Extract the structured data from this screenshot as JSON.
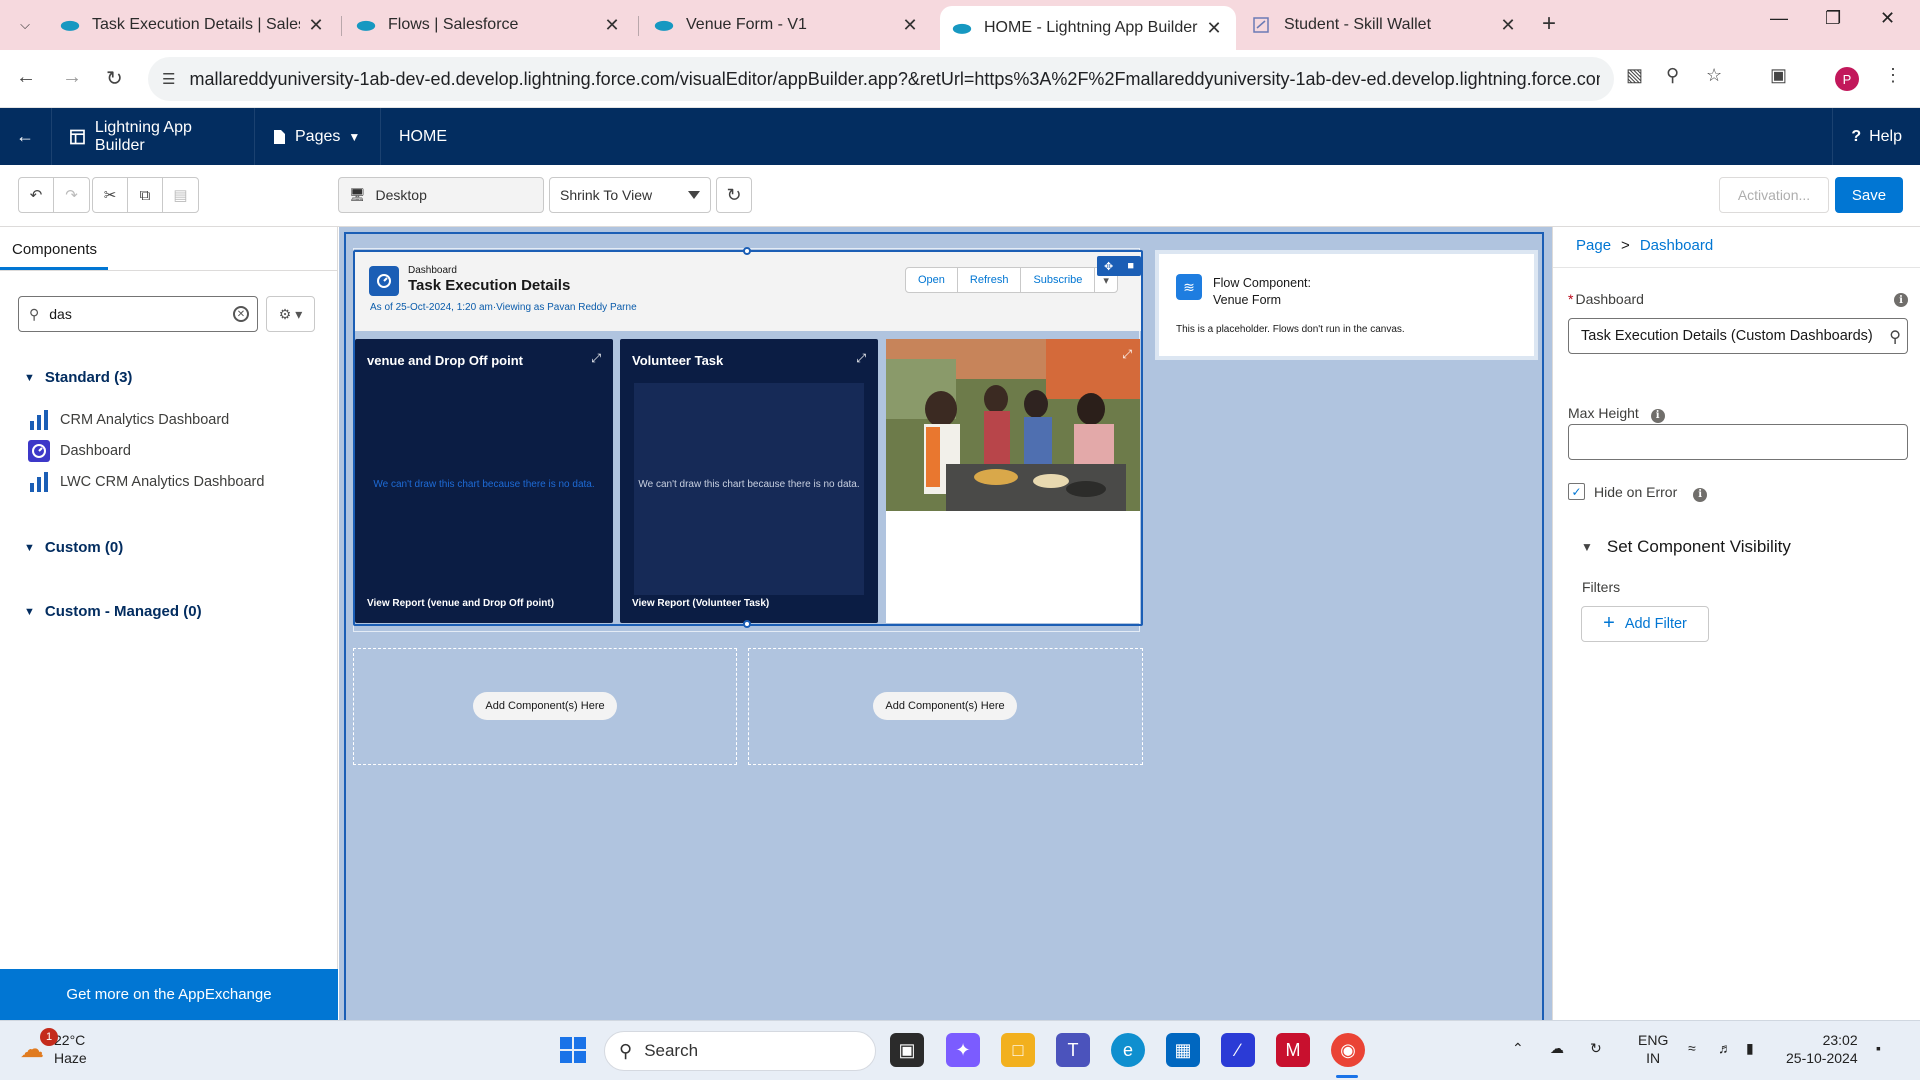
{
  "browser": {
    "tabs": [
      {
        "title": "Task Execution Details | Salesforce",
        "active": false
      },
      {
        "title": "Flows | Salesforce",
        "active": false
      },
      {
        "title": "Venue Form - V1",
        "active": false
      },
      {
        "title": "HOME - Lightning App Builder",
        "active": true
      },
      {
        "title": "Student - Skill Wallet",
        "active": false
      }
    ],
    "url": "mallareddyuniversity-1ab-dev-ed.develop.lightning.force.com/visualEditor/appBuilder.app?&retUrl=https%3A%2F%2Fmallareddyuniversity-1ab-dev-ed.develop.lightning.force.com%...",
    "profile_initial": "P"
  },
  "header": {
    "app_name": "Lightning App Builder",
    "pages_label": "Pages",
    "page_name": "HOME",
    "help_label": "Help"
  },
  "toolbar": {
    "device": "Desktop",
    "zoom": "Shrink To View",
    "activation_label": "Activation...",
    "save_label": "Save"
  },
  "left_panel": {
    "tab_label": "Components",
    "search_value": "das",
    "sections": {
      "standard": "Standard (3)",
      "custom": "Custom (0)",
      "managed": "Custom - Managed (0)"
    },
    "items": [
      "CRM Analytics Dashboard",
      "Dashboard",
      "LWC CRM Analytics Dashboard"
    ],
    "appexchange_label": "Get more on the AppExchange"
  },
  "canvas": {
    "dashboard": {
      "small_label": "Dashboard",
      "title": "Task Execution Details",
      "meta": "As of 25-Oct-2024, 1:20 am·Viewing as Pavan Reddy Parne",
      "buttons": [
        "Open",
        "Refresh",
        "Subscribe"
      ],
      "widgets": [
        {
          "title": "venue and Drop Off point",
          "nodata": "We can't draw this chart because there is no data.",
          "report": "View Report (venue and Drop Off point)"
        },
        {
          "title": "Volunteer Task",
          "nodata": "We can't draw this chart because there is no data.",
          "report": "View Report (Volunteer Task)"
        }
      ]
    },
    "add_component_label": "Add Component(s) Here",
    "flow": {
      "line1": "Flow Component:",
      "line2": "Venue Form",
      "placeholder": "This is a placeholder. Flows don't run in the canvas."
    }
  },
  "right_panel": {
    "breadcrumb_root": "Page",
    "breadcrumb_sep": ">",
    "breadcrumb_current": "Dashboard",
    "dashboard_label": "Dashboard",
    "dashboard_value": "Task Execution Details (Custom Dashboards)",
    "max_height_label": "Max Height",
    "max_height_value": "",
    "hide_on_error_label": "Hide on Error",
    "hide_on_error_checked": true,
    "visibility_label": "Set Component Visibility",
    "filters_label": "Filters",
    "add_filter_label": "Add Filter"
  },
  "taskbar": {
    "temperature": "22°C",
    "condition": "Haze",
    "weather_badge": "1",
    "search_label": "Search",
    "lang1": "ENG",
    "lang2": "IN",
    "time": "23:02",
    "date": "25-10-2024"
  },
  "colors": {
    "sf_header": "#032d60",
    "brand_blue": "#0176d3",
    "canvas_bg": "#b0c4df",
    "widget_bg": "#0b1d44",
    "tab_strip": "#f6d9de"
  }
}
